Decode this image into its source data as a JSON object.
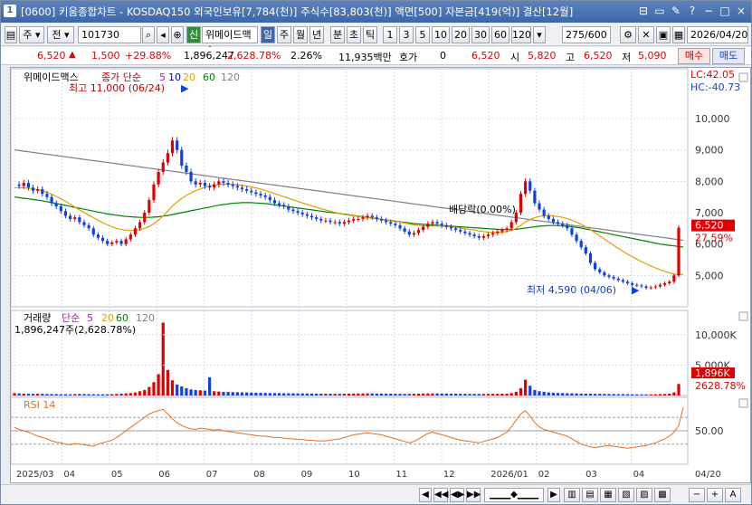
{
  "window": {
    "title": "[0600] 키움종합차트 - KOSDAQ150 외국인보유[7,784(천)] 주식수[83,803(천)] 액면[500] 자본금[419(억)] 결산[12월]",
    "icon_label": "1",
    "buttons": [
      "⊟",
      "▭",
      "✎",
      "?",
      "−",
      "□",
      "×"
    ]
  },
  "toolbar": {
    "period": "주",
    "market": "전",
    "code": "101730",
    "badge": "신",
    "stock_name": "위메이드맥스",
    "unit_buttons": [
      "일",
      "주",
      "월",
      "년",
      "분",
      "초",
      "틱"
    ],
    "interval_buttons": [
      "1",
      "3",
      "5",
      "10",
      "20",
      "30",
      "60",
      "120"
    ],
    "count": "275/600",
    "date": "2026/04/20"
  },
  "quote": {
    "price": "6,520",
    "change": "1,500",
    "change_pct": "+29.88%",
    "volume": "1,896,247",
    "volume_pct": "2,628.78%",
    "turnover_pct": "2.26%",
    "amount": "11,935백만",
    "hoga_label": "호가",
    "hoga_value": "0",
    "hoga_price": "6,520",
    "open_label": "시",
    "open": "5,820",
    "high_label": "고",
    "high": "6,520",
    "low_label": "저",
    "low": "5,090",
    "buy_label": "매수",
    "sell_label": "매도"
  },
  "chart_data": {
    "type": "line",
    "title": "위메이드맥스",
    "legend": {
      "price_label": "종가 단순",
      "ma_periods": [
        "5",
        "10",
        "20",
        "60",
        "120"
      ],
      "ma_colors": [
        "#d400d4",
        "#0000d0",
        "#e0a000",
        "#008000",
        "#808080"
      ]
    },
    "x_ticks": [
      "2025/03",
      "04",
      "05",
      "06",
      "07",
      "08",
      "09",
      "10",
      "11",
      "12",
      "2026/01",
      "02",
      "03",
      "04",
      "04/20"
    ],
    "price_axis": {
      "ticks": [
        "10,000",
        "9,000",
        "8,000",
        "7,000",
        "6,000",
        "5,000"
      ],
      "ylim": [
        4000,
        11500
      ]
    },
    "lc": "LC:42.05",
    "hc": "HC:-40.73",
    "current_price_label": "6,520",
    "current_pct_label": "27.59%",
    "annotations": {
      "high": "최고 11,000 (06/24)",
      "low": "최저 4,590 (04/06)",
      "dividend": "배당락(0.00%)"
    },
    "close": [
      7900,
      7850,
      7950,
      7800,
      7700,
      7750,
      7600,
      7500,
      7300,
      7200,
      7050,
      6900,
      6800,
      6850,
      6700,
      6600,
      6500,
      6300,
      6200,
      6100,
      6000,
      6050,
      6100,
      6000,
      6150,
      6300,
      6500,
      6700,
      7000,
      7400,
      7900,
      8300,
      8600,
      8900,
      9300,
      9000,
      8500,
      8300,
      8000,
      7900,
      7950,
      7850,
      7800,
      7900,
      8000,
      7950,
      7900,
      7850,
      7800,
      7750,
      7700,
      7650,
      7600,
      7550,
      7500,
      7400,
      7300,
      7250,
      7200,
      7100,
      7050,
      7000,
      6950,
      6900,
      6850,
      6800,
      6750,
      6750,
      6700,
      6700,
      6650,
      6700,
      6750,
      6800,
      6800,
      6850,
      6900,
      6850,
      6800,
      6750,
      6700,
      6650,
      6600,
      6500,
      6400,
      6300,
      6350,
      6450,
      6550,
      6650,
      6700,
      6650,
      6600,
      6550,
      6500,
      6450,
      6400,
      6350,
      6300,
      6250,
      6200,
      6250,
      6300,
      6350,
      6400,
      6450,
      6500,
      6700,
      7000,
      7600,
      8000,
      7700,
      7300,
      7100,
      6900,
      6800,
      6700,
      6650,
      6600,
      6500,
      6300,
      6100,
      5900,
      5700,
      5400,
      5200,
      5100,
      5000,
      4950,
      4900,
      4850,
      4800,
      4750,
      4700,
      4680,
      4650,
      4600,
      4620,
      4650,
      4700,
      4750,
      4800,
      5000,
      6520
    ],
    "ma20": [
      7800,
      7800,
      7790,
      7780,
      7760,
      7730,
      7690,
      7650,
      7590,
      7520,
      7440,
      7360,
      7270,
      7180,
      7090,
      7010,
      6920,
      6840,
      6760,
      6680,
      6610,
      6550,
      6500,
      6460,
      6440,
      6430,
      6440,
      6460,
      6500,
      6560,
      6650,
      6760,
      6900,
      7050,
      7210,
      7340,
      7450,
      7550,
      7630,
      7700,
      7760,
      7810,
      7850,
      7880,
      7900,
      7910,
      7910,
      7900,
      7890,
      7870,
      7850,
      7820,
      7790,
      7750,
      7710,
      7660,
      7610,
      7560,
      7510,
      7460,
      7410,
      7360,
      7310,
      7260,
      7220,
      7170,
      7130,
      7090,
      7050,
      7010,
      6970,
      6940,
      6920,
      6900,
      6880,
      6860,
      6840,
      6820,
      6800,
      6780,
      6760,
      6740,
      6720,
      6700,
      6670,
      6640,
      6610,
      6590,
      6580,
      6580,
      6580,
      6580,
      6570,
      6560,
      6550,
      6530,
      6510,
      6490,
      6470,
      6450,
      6420,
      6400,
      6380,
      6370,
      6370,
      6380,
      6400,
      6440,
      6500,
      6600,
      6700,
      6780,
      6840,
      6880,
      6900,
      6910,
      6900,
      6880,
      6850,
      6810,
      6760,
      6700,
      6630,
      6550,
      6460,
      6360,
      6260,
      6160,
      6060,
      5960,
      5860,
      5770,
      5680,
      5600,
      5520,
      5440,
      5370,
      5300,
      5240,
      5180,
      5130,
      5080,
      5040,
      5020,
      5040
    ],
    "ma60": [
      7500,
      7480,
      7460,
      7440,
      7420,
      7400,
      7380,
      7350,
      7320,
      7290,
      7260,
      7230,
      7200,
      7170,
      7140,
      7110,
      7080,
      7050,
      7020,
      6990,
      6960,
      6940,
      6920,
      6900,
      6880,
      6870,
      6860,
      6850,
      6850,
      6850,
      6860,
      6870,
      6890,
      6910,
      6940,
      6970,
      7000,
      7030,
      7060,
      7090,
      7120,
      7150,
      7180,
      7210,
      7240,
      7260,
      7280,
      7300,
      7310,
      7320,
      7320,
      7320,
      7310,
      7300,
      7290,
      7270,
      7250,
      7230,
      7210,
      7190,
      7170,
      7150,
      7130,
      7110,
      7090,
      7070,
      7050,
      7030,
      7010,
      6990,
      6970,
      6950,
      6930,
      6910,
      6890,
      6870,
      6850,
      6830,
      6810,
      6790,
      6770,
      6750,
      6730,
      6710,
      6690,
      6670,
      6650,
      6640,
      6630,
      6620,
      6610,
      6600,
      6590,
      6580,
      6570,
      6560,
      6550,
      6540,
      6530,
      6520,
      6510,
      6500,
      6490,
      6480,
      6470,
      6460,
      6460,
      6460,
      6470,
      6490,
      6510,
      6530,
      6550,
      6570,
      6580,
      6590,
      6590,
      6590,
      6580,
      6570,
      6550,
      6530,
      6510,
      6480,
      6450,
      6420,
      6390,
      6360,
      6330,
      6300,
      6270,
      6240,
      6210,
      6180,
      6150,
      6120,
      6090,
      6060,
      6030,
      6000,
      5980,
      5960,
      5940,
      5920,
      5900
    ],
    "ma120": [
      9000,
      8980,
      8960,
      8940,
      8920,
      8900,
      8880,
      8860,
      8840,
      8820,
      8800,
      8780,
      8760,
      8740,
      8720,
      8700,
      8680,
      8660,
      8640,
      8620,
      8600,
      8580,
      8560,
      8540,
      8520,
      8500,
      8480,
      8460,
      8440,
      8420,
      8400,
      8380,
      8360,
      8340,
      8320,
      8300,
      8280,
      8260,
      8240,
      8220,
      8200,
      8180,
      8160,
      8140,
      8120,
      8100,
      8080,
      8060,
      8040,
      8020,
      8000,
      7980,
      7960,
      7940,
      7920,
      7900,
      7880,
      7860,
      7840,
      7820,
      7800,
      7780,
      7760,
      7740,
      7720,
      7700,
      7680,
      7660,
      7640,
      7620,
      7600,
      7580,
      7560,
      7540,
      7520,
      7500,
      7480,
      7460,
      7440,
      7420,
      7400,
      7380,
      7360,
      7340,
      7320,
      7300,
      7280,
      7260,
      7240,
      7220,
      7200,
      7180,
      7160,
      7140,
      7120,
      7100,
      7080,
      7060,
      7040,
      7020,
      7000,
      6980,
      6960,
      6940,
      6920,
      6900,
      6880,
      6860,
      6840,
      6820,
      6800,
      6780,
      6760,
      6740,
      6720,
      6700,
      6680,
      6660,
      6640,
      6620,
      6600,
      6580,
      6560,
      6540,
      6520,
      6500,
      6480,
      6460,
      6440,
      6420,
      6400,
      6380,
      6360,
      6340,
      6320,
      6300,
      6280,
      6260,
      6240,
      6220,
      6200,
      6180,
      6160,
      6140,
      6120
    ],
    "volume_panel": {
      "label": "거래량",
      "legend": [
        "단순",
        "5",
        "20",
        "60",
        "120"
      ],
      "value_text": "1,896,247주(2,628.78%)",
      "ticks": [
        "10,000K",
        "5,000K"
      ],
      "current_label": "1,896K",
      "current_pct": "2628.78%",
      "ylim": [
        0,
        14000
      ],
      "values": [
        400,
        350,
        300,
        280,
        260,
        300,
        280,
        250,
        240,
        230,
        220,
        210,
        200,
        220,
        250,
        230,
        220,
        210,
        200,
        190,
        200,
        220,
        260,
        300,
        350,
        400,
        500,
        700,
        900,
        1400,
        2200,
        3500,
        12000,
        4200,
        2500,
        1800,
        1500,
        1200,
        1000,
        900,
        850,
        800,
        3000,
        700,
        650,
        600,
        580,
        560,
        540,
        520,
        500,
        480,
        460,
        440,
        420,
        410,
        400,
        390,
        380,
        370,
        360,
        350,
        340,
        330,
        320,
        310,
        300,
        300,
        290,
        290,
        280,
        280,
        300,
        320,
        330,
        340,
        350,
        340,
        330,
        320,
        310,
        300,
        290,
        280,
        270,
        260,
        280,
        300,
        320,
        340,
        350,
        340,
        330,
        320,
        310,
        300,
        290,
        280,
        270,
        260,
        250,
        260,
        270,
        280,
        290,
        300,
        310,
        400,
        600,
        1200,
        2600,
        1600,
        900,
        700,
        600,
        500,
        450,
        420,
        400,
        380,
        360,
        340,
        320,
        300,
        290,
        280,
        270,
        260,
        250,
        240,
        230,
        220,
        210,
        200,
        190,
        180,
        180,
        190,
        200,
        220,
        250,
        300,
        500,
        1896
      ]
    },
    "rsi_panel": {
      "label": "RSI 14",
      "tick": "50.00",
      "ylim": [
        0,
        100
      ],
      "values": [
        55,
        52,
        50,
        48,
        45,
        42,
        40,
        38,
        35,
        33,
        32,
        30,
        29,
        31,
        30,
        29,
        28,
        27,
        30,
        32,
        34,
        36,
        40,
        45,
        50,
        55,
        60,
        65,
        70,
        75,
        78,
        80,
        82,
        75,
        68,
        62,
        58,
        55,
        53,
        52,
        54,
        53,
        52,
        51,
        52,
        50,
        49,
        48,
        47,
        46,
        45,
        44,
        43,
        42,
        42,
        41,
        40,
        40,
        39,
        38,
        38,
        37,
        37,
        36,
        36,
        35,
        35,
        35,
        36,
        37,
        38,
        40,
        42,
        44,
        45,
        46,
        47,
        46,
        45,
        44,
        42,
        40,
        38,
        36,
        34,
        32,
        34,
        38,
        42,
        46,
        48,
        46,
        44,
        42,
        40,
        38,
        36,
        35,
        34,
        33,
        32,
        34,
        36,
        38,
        40,
        44,
        48,
        56,
        66,
        75,
        80,
        72,
        62,
        56,
        52,
        50,
        48,
        46,
        44,
        42,
        38,
        34,
        30,
        28,
        26,
        25,
        26,
        27,
        28,
        27,
        26,
        25,
        24,
        25,
        26,
        27,
        28,
        30,
        32,
        35,
        38,
        42,
        48,
        58,
        85
      ]
    }
  },
  "bottombar": {
    "buttons": [
      "◀",
      "◀◀",
      "◀▶",
      "▶▶",
      "▶"
    ],
    "zoom_buttons": [
      "−",
      "+",
      "A"
    ]
  }
}
